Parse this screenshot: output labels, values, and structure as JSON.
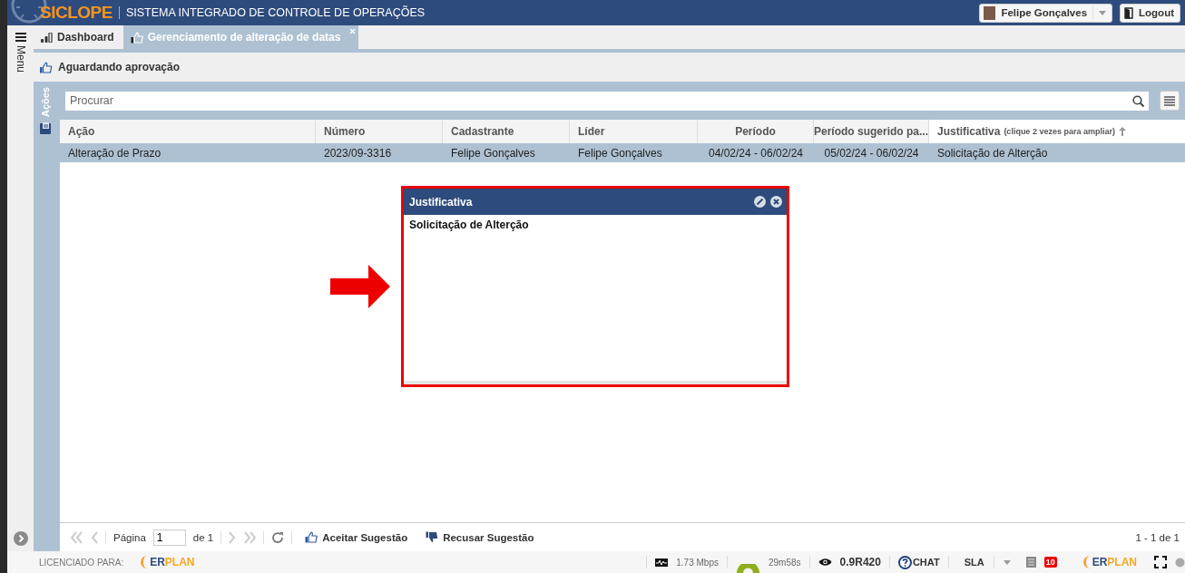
{
  "header": {
    "brand": "SICLOPE",
    "system_title": "SISTEMA INTEGRADO DE CONTROLE DE OPERAÇÕES",
    "user": "Felipe Gonçalves",
    "logout": "Logout"
  },
  "sidebar": {
    "menu_label": "Menu",
    "actions_label": "Ações"
  },
  "tabs": [
    {
      "label": "Dashboard",
      "selected": false
    },
    {
      "label": "Gerenciamento de alteração de datas",
      "selected": true
    }
  ],
  "section_title": "Aguardando aprovação",
  "search": {
    "placeholder": "Procurar"
  },
  "table": {
    "columns": [
      {
        "label": "Ação"
      },
      {
        "label": "Número"
      },
      {
        "label": "Cadastrante"
      },
      {
        "label": "Líder"
      },
      {
        "label": "Período"
      },
      {
        "label": "Período sugerido pa..."
      },
      {
        "label": "Justificativa",
        "hint": "(clique 2 vezes para ampliar)"
      }
    ],
    "rows": [
      {
        "selected": true,
        "cells": [
          "Alteração de Prazo",
          "2023/09-3316",
          "Felipe Gonçalves",
          "Felipe Gonçalves",
          "04/02/24 - 06/02/24",
          "05/02/24 - 06/02/24",
          "Solicitação de Alterção"
        ]
      }
    ]
  },
  "dialog": {
    "title": "Justificativa",
    "body": "Solicitação de Alterção",
    "highlighted": true
  },
  "pager": {
    "page_label": "Página",
    "page_value": "1",
    "of_label": "de 1",
    "accept": "Aceitar Sugestão",
    "reject": "Recusar Sugestão",
    "range": "1 - 1 de 1"
  },
  "status_bar": {
    "licensed_label": "LICENCIADO PARA:",
    "logo_prefix": "ER",
    "logo_suffix": "PLAN",
    "speed": "1.73 Mbps",
    "timer": "29m58s",
    "version": "0.9R420",
    "chat": "CHAT",
    "sla": "SLA",
    "badge": "10",
    "logo2_prefix": "ER",
    "logo2_suffix": "PLAN"
  }
}
